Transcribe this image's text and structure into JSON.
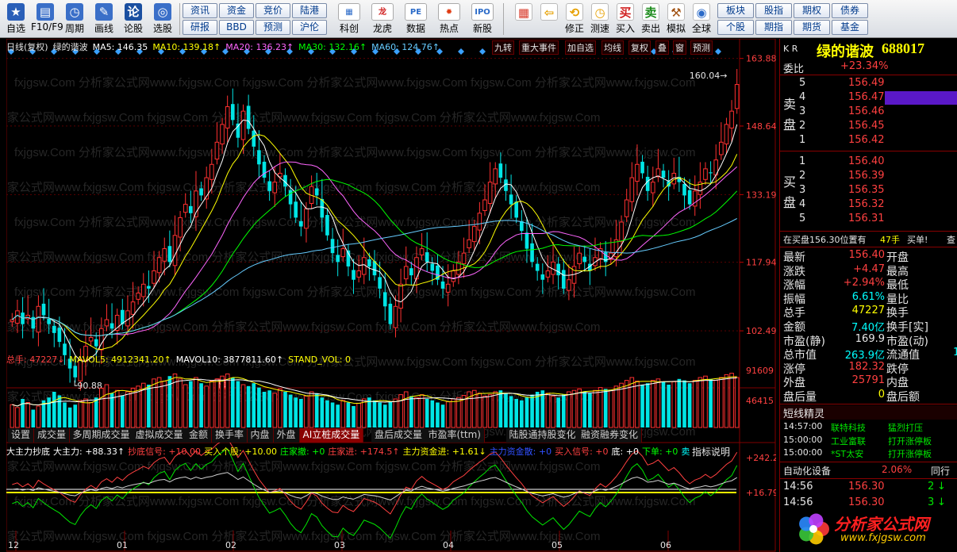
{
  "toolbar": {
    "left": [
      {
        "name": "self-select",
        "label": "自选",
        "icon": "★",
        "color": "#2a5fb8"
      },
      {
        "name": "f10",
        "label": "F10/F9",
        "icon": "▤",
        "color": "#3a6fc8"
      },
      {
        "name": "period",
        "label": "周期",
        "icon": "◷",
        "color": "#3a6fc8"
      },
      {
        "name": "draw-line",
        "label": "画线",
        "icon": "✎",
        "color": "#3a6fc8"
      },
      {
        "name": "stock-review",
        "label": "论股",
        "icon": "论",
        "color": "#1a4fa0"
      },
      {
        "name": "stock-pick",
        "label": "选股",
        "icon": "◎",
        "color": "#3a6fc8"
      }
    ],
    "grid_buttons": [
      "资讯",
      "资金",
      "竞价",
      "陆港",
      "研报",
      "BBD",
      "预测",
      "沪伦"
    ],
    "mid": [
      {
        "name": "sci-innovation",
        "label": "科创",
        "icon": "▦",
        "color": "#2a6ac8"
      },
      {
        "name": "dragon-tiger",
        "label": "龙虎",
        "icon": "龙",
        "color": "#d02020"
      },
      {
        "name": "data",
        "label": "数据",
        "icon": "PE",
        "color": "#2a6ac8"
      },
      {
        "name": "hot-spot",
        "label": "热点",
        "icon": "✹",
        "color": "#e03a10"
      },
      {
        "name": "new-ipo",
        "label": "新股",
        "icon": "IPO",
        "color": "#2a6ac8"
      }
    ],
    "right": [
      {
        "name": "tile",
        "label": "",
        "icon": "▦",
        "color": "#d83a2a"
      },
      {
        "name": "back",
        "label": "",
        "icon": "⇦",
        "color": "#e6a000"
      },
      {
        "name": "revise",
        "label": "修正",
        "icon": "⟲",
        "color": "#e6a000"
      },
      {
        "name": "backtest",
        "label": "测速",
        "icon": "◷",
        "color": "#e6a000"
      },
      {
        "name": "buy",
        "label": "买入",
        "icon": "买",
        "color": "#d02020"
      },
      {
        "name": "sell",
        "label": "卖出",
        "icon": "卖",
        "color": "#1a8a1a"
      },
      {
        "name": "simulate",
        "label": "模拟",
        "icon": "⚒",
        "color": "#a05010"
      },
      {
        "name": "global",
        "label": "全球",
        "icon": "◉",
        "color": "#2a6ac8"
      }
    ],
    "right_grid": [
      "板块",
      "股指",
      "期权",
      "债券",
      "个股",
      "期指",
      "期货",
      "基金"
    ]
  },
  "chart": {
    "title_parts": [
      {
        "text": "日线(复权)",
        "color": "#e6e6e6"
      },
      {
        "text": "绿的谐波",
        "color": "#e6e6e6"
      },
      {
        "text": "MA5: 146.35",
        "color": "#ffffff"
      },
      {
        "text": "MA10: 139.18↑",
        "color": "#ffff00"
      },
      {
        "text": "MA20: 136.23↑",
        "color": "#ff66ff"
      },
      {
        "text": "MA30: 132.16↑",
        "color": "#00ff00"
      },
      {
        "text": "MA60: 124.76↑",
        "color": "#66ccff"
      }
    ],
    "top_tabs": [
      "九转",
      "重大事件",
      "加自选",
      "均线",
      "复权",
      "叠",
      "窗",
      "预测"
    ],
    "price_axis": [
      "163.88",
      "148.64",
      "133.19",
      "117.94",
      "102.49"
    ],
    "high_label": "160.04",
    "low_label": "90.88",
    "bang_label": "榜",
    "volume_parts": [
      {
        "text": "总手: 47227↓",
        "color": "#ff4040"
      },
      {
        "text": "MAVOL5: 4912341.20↑",
        "color": "#ffff00"
      },
      {
        "text": "MAVOL10: 3877811.60↑",
        "color": "#ffffff"
      },
      {
        "text": "STAND_VOL: 0",
        "color": "#ffff00"
      }
    ],
    "volume_axis": [
      "91609",
      "46415"
    ],
    "indicator_tabs": [
      "设置",
      "成交量",
      "多周期成交量",
      "虚拟成交量",
      "金额",
      "换手率",
      "内盘",
      "外盘",
      "AI立桩成交量",
      "盘后成交量",
      "市盈率(ttm)",
      "陆股通持股变化",
      "融资融券变化"
    ],
    "active_tab": "AI立桩成交量",
    "indicator_parts": [
      {
        "text": "大主力抄底",
        "color": "#ffffff"
      },
      {
        "text": "大主力: +88.33↑",
        "color": "#ffffff"
      },
      {
        "text": "抄底信号: +10.00",
        "color": "#ff4040"
      },
      {
        "text": "买入个股: +10.00",
        "color": "#ffff00"
      },
      {
        "text": "庄家撤: +0",
        "color": "#00ff00"
      },
      {
        "text": "庄家进: +174.5↑",
        "color": "#ff4040"
      },
      {
        "text": "主力资金进: +1.61↓",
        "color": "#ffff00"
      },
      {
        "text": "主力资金散: +0",
        "color": "#3050ff"
      },
      {
        "text": "买入信号: +0",
        "color": "#ff4040"
      },
      {
        "text": "底: +0",
        "color": "#ffffff"
      },
      {
        "text": "下单: +0",
        "color": "#00ff00"
      },
      {
        "text": "卖",
        "color": "#00ffff"
      }
    ],
    "indicator_help": "指标说明",
    "indicator_axis": [
      "+242.2",
      "+16.79"
    ],
    "months": [
      "12",
      "01",
      "02",
      "03",
      "04",
      "05",
      "06"
    ],
    "watermark": "fxjgsw.Com 分析家公式网www.fxjgsw.Com"
  },
  "chart_data": {
    "type": "candlestick",
    "title": "日线(复权) 绿的谐波",
    "ylim": [
      90,
      164
    ],
    "y_ticks": [
      102.49,
      117.94,
      133.19,
      148.64,
      163.88
    ],
    "x_ticks": [
      "12",
      "01",
      "02",
      "03",
      "04",
      "05",
      "06"
    ],
    "high": 160.04,
    "low": 90.88,
    "ma": [
      {
        "name": "MA5",
        "value": 146.35,
        "color": "#ffffff"
      },
      {
        "name": "MA10",
        "value": 139.18,
        "color": "#ffff00"
      },
      {
        "name": "MA20",
        "value": 136.23,
        "color": "#ff66ff"
      },
      {
        "name": "MA30",
        "value": 132.16,
        "color": "#00ff00"
      },
      {
        "name": "MA60",
        "value": 124.76,
        "color": "#66ccff"
      }
    ],
    "close": [
      105,
      107,
      104,
      106,
      103,
      108,
      106,
      104,
      102,
      100,
      97,
      94,
      92,
      96,
      99,
      101,
      99,
      103,
      105,
      103,
      106,
      104,
      107,
      109,
      111,
      113,
      112,
      116,
      119,
      121,
      118,
      124,
      128,
      131,
      129,
      134,
      133,
      137,
      140,
      145,
      149,
      153,
      150,
      146,
      152,
      148,
      144,
      140,
      137,
      134,
      136,
      138,
      135,
      131,
      128,
      126,
      130,
      135,
      133,
      128,
      124,
      120,
      118,
      121,
      117,
      114,
      116,
      119,
      117,
      115,
      112,
      108,
      104,
      108,
      113,
      117,
      115,
      119,
      121,
      118,
      116,
      114,
      112,
      113,
      116,
      118,
      120,
      123,
      126,
      129,
      132,
      136,
      139,
      137,
      134,
      131,
      128,
      125,
      121,
      118,
      116,
      114,
      116,
      118,
      115,
      112,
      114,
      117,
      120,
      118,
      116,
      119,
      121,
      118,
      120,
      123,
      127,
      132,
      137,
      140,
      138,
      134,
      136,
      139,
      137,
      135,
      138,
      136,
      133,
      131,
      134,
      136,
      139,
      138,
      141,
      145,
      149,
      152,
      158
    ],
    "volume": [
      52,
      48,
      60,
      55,
      45,
      50,
      58,
      62,
      70,
      65,
      55,
      48,
      52,
      58,
      60,
      55,
      62,
      75,
      80,
      68,
      72,
      65,
      70,
      75,
      78,
      82,
      80,
      88,
      90,
      85,
      92,
      95,
      88,
      80,
      85,
      90,
      82,
      78,
      85,
      88,
      92,
      95,
      90,
      85,
      80,
      78,
      82,
      76,
      70,
      72,
      68,
      74,
      70,
      66,
      62,
      60,
      64,
      70,
      68,
      62,
      58,
      55,
      52,
      58,
      55,
      50,
      54,
      60,
      62,
      58,
      55,
      52,
      56,
      60,
      66,
      70,
      64,
      62,
      66,
      60,
      58,
      55,
      52,
      56,
      60,
      62,
      65,
      70,
      72,
      68,
      64,
      66,
      70,
      72,
      68,
      64,
      60,
      58,
      62,
      66,
      70,
      72,
      68,
      64,
      62,
      66,
      70,
      72,
      74,
      70,
      68,
      72,
      76,
      74,
      72,
      78,
      82,
      86,
      90,
      85,
      80,
      82,
      86,
      88,
      84,
      80,
      84,
      88,
      86,
      82,
      86,
      90,
      92,
      88,
      86,
      90,
      94,
      96,
      90
    ]
  },
  "quote": {
    "code_label": "K R",
    "name": "绿的谐波",
    "code": "688017",
    "committee_label": "委比",
    "committee_value": "+23.34%",
    "sell_label": [
      "卖",
      "盘"
    ],
    "buy_label": [
      "买",
      "盘"
    ],
    "asks": [
      {
        "lvl": "5",
        "price": "156.49"
      },
      {
        "lvl": "4",
        "price": "156.47"
      },
      {
        "lvl": "3",
        "price": "156.46"
      },
      {
        "lvl": "2",
        "price": "156.45"
      },
      {
        "lvl": "1",
        "price": "156.42"
      }
    ],
    "bids": [
      {
        "lvl": "1",
        "price": "156.40"
      },
      {
        "lvl": "2",
        "price": "156.39"
      },
      {
        "lvl": "3",
        "price": "156.35"
      },
      {
        "lvl": "4",
        "price": "156.32"
      },
      {
        "lvl": "5",
        "price": "156.31"
      }
    ],
    "order_notice_a": "在买盘156.30位置有",
    "order_notice_b": "47手",
    "order_notice_c": "买单!",
    "order_notice_d": "查",
    "stats": [
      {
        "k1": "最新",
        "v1": "156.40",
        "c1": "red",
        "k2": "开盘"
      },
      {
        "k1": "涨跌",
        "v1": "+4.47",
        "c1": "red",
        "k2": "最高"
      },
      {
        "k1": "涨幅",
        "v1": "+2.94%",
        "c1": "red",
        "k2": "最低"
      },
      {
        "k1": "振幅",
        "v1": "6.61%",
        "c1": "cyan",
        "k2": "量比"
      },
      {
        "k1": "总手",
        "v1": "47227",
        "c1": "yel",
        "k2": "换手"
      },
      {
        "k1": "金额",
        "v1": "7.40亿",
        "c1": "cyan",
        "k2": "换手[实]"
      },
      {
        "k1": "市盈(静)",
        "v1": "169.9",
        "c1": "wht",
        "k2": "市盈(动)"
      },
      {
        "k1": "总市值",
        "v1": "263.9亿",
        "c1": "cyan",
        "k2": "流通值",
        "v2": "1"
      },
      {
        "k1": "涨停",
        "v1": "182.32",
        "c1": "red",
        "k2": "跌停"
      },
      {
        "k1": "外盘",
        "v1": "25791",
        "c1": "red",
        "k2": "内盘"
      },
      {
        "k1": "盘后量",
        "v1": "0",
        "c1": "yel",
        "k2": "盘后额"
      }
    ],
    "short_title": "短线精灵",
    "short_items": [
      {
        "time": "14:57:00",
        "name": "联特科技",
        "event": "猛烈打压",
        "color": "#00e600"
      },
      {
        "time": "15:00:00",
        "name": "工业富联",
        "event": "打开涨停板",
        "color": "#00e600"
      },
      {
        "time": "15:00:00",
        "name": "*ST太安",
        "event": "打开涨停板",
        "color": "#00e600"
      }
    ],
    "sector_name": "自动化设备",
    "sector_change": "2.06%",
    "sector_more": "同行",
    "ticks": [
      {
        "time": "14:56",
        "price": "156.30",
        "vol": "2",
        "arrow": "↓"
      },
      {
        "time": "14:56",
        "price": "156.30",
        "vol": "3",
        "arrow": "↓"
      }
    ],
    "logo_text": "分析家公式网",
    "logo_url": "www.fxjgsw.com"
  }
}
